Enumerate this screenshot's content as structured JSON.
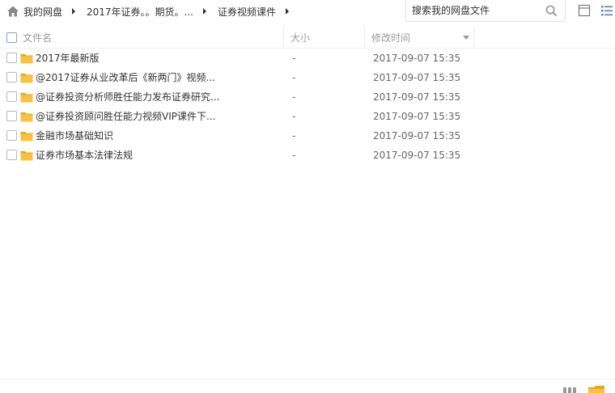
{
  "breadcrumb": {
    "home_icon": "home-icon",
    "items": [
      {
        "label": "我的网盘"
      },
      {
        "label": "2017年证券。。期货。..."
      },
      {
        "label": "证券视频课件"
      }
    ]
  },
  "search": {
    "placeholder": "搜索我的网盘文件",
    "icon": "search-icon"
  },
  "view": {
    "single_icon": "single-view-icon",
    "list_icon": "list-view-icon"
  },
  "header": {
    "name": "文件名",
    "size": "大小",
    "mtime": "修改时间"
  },
  "files": [
    {
      "name": "2017年最新版",
      "size": "-",
      "mtime": "2017-09-07 15:35"
    },
    {
      "name": "@2017证券从业改革后《新两门》视频...",
      "size": "-",
      "mtime": "2017-09-07 15:35"
    },
    {
      "name": "@证券投资分析师胜任能力发布证券研究...",
      "size": "-",
      "mtime": "2017-09-07 15:35"
    },
    {
      "name": "@证券投资顾问胜任能力视频VIP课件下...",
      "size": "-",
      "mtime": "2017-09-07 15:35"
    },
    {
      "name": "金融市场基础知识",
      "size": "-",
      "mtime": "2017-09-07 15:35"
    },
    {
      "name": "证券市场基本法律法规",
      "size": "-",
      "mtime": "2017-09-07 15:35"
    }
  ],
  "colors": {
    "folder": "#f7c242",
    "folder_dark": "#e6a817",
    "accent": "#3b8cff"
  }
}
